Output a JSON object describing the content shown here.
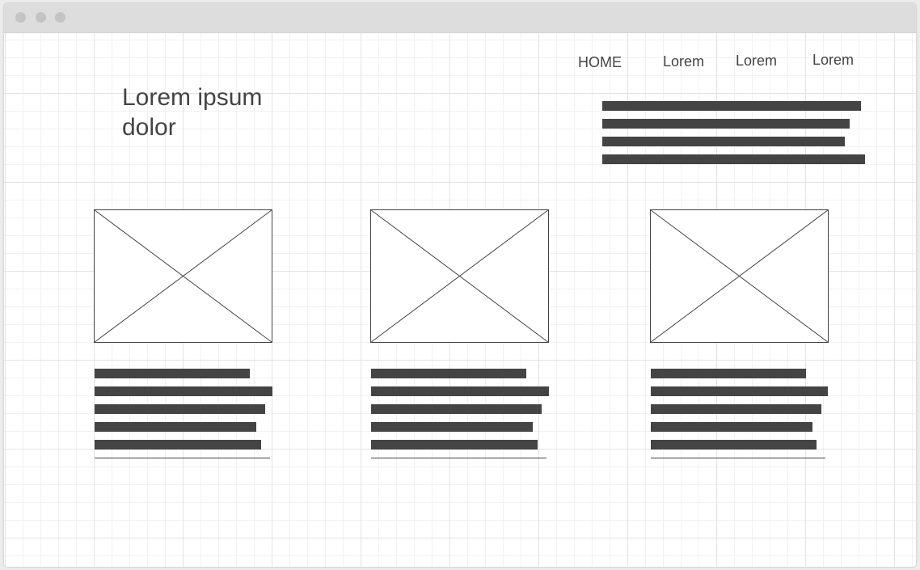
{
  "nav": {
    "items": [
      {
        "label": "HOME"
      },
      {
        "label": "Lorem"
      },
      {
        "label": "Lorem"
      },
      {
        "label": "Lorem"
      }
    ]
  },
  "hero": {
    "title_line1": "Lorem ipsum",
    "title_line2": "dolor"
  },
  "colors": {
    "text": "#444444",
    "bars": "#444444",
    "grid_major": "#e3e3e3",
    "grid_minor": "#f1f1f1",
    "titlebar": "#dddddd"
  },
  "cards_count": 3
}
